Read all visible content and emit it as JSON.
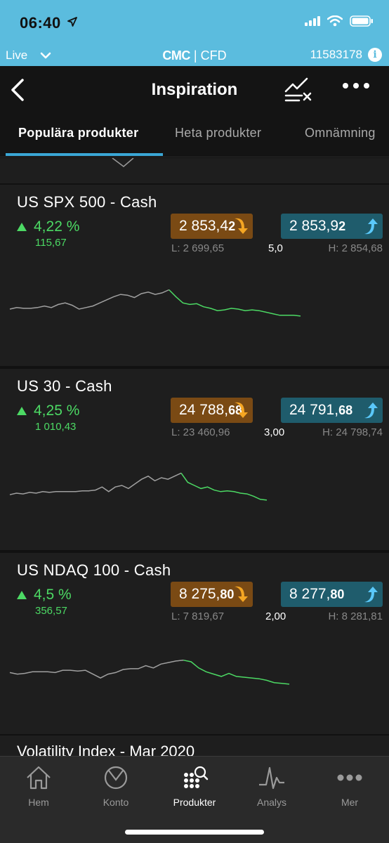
{
  "status": {
    "time": "06:40"
  },
  "subbar": {
    "mode": "Live",
    "brand_logo": "CMC",
    "brand_suffix": "| CFD",
    "account": "11583178"
  },
  "nav": {
    "title": "Inspiration"
  },
  "tabs": [
    {
      "label": "Populära produkter",
      "active": true
    },
    {
      "label": "Heta produkter",
      "active": false
    },
    {
      "label": "Omnämning",
      "active": false
    }
  ],
  "colors": {
    "accent": "#3ba7d6",
    "up": "#4cd964",
    "sell": "#7a4a14",
    "buy": "#1f5c6c",
    "arrow_sell": "#f5a623",
    "arrow_buy": "#5ac8fa"
  },
  "products": [
    {
      "name": "US SPX 500 - Cash",
      "change_pct": "4,22 %",
      "change_abs": "115,67",
      "sell_main": "2 853,4",
      "sell_big": "2",
      "buy_main": "2 853,9",
      "buy_big": "2",
      "low": "L: 2 699,65",
      "spread": "5,0",
      "high": "H: 2 854,68",
      "spark": [
        0.5,
        0.6,
        0.55,
        0.55,
        0.6,
        0.7,
        0.6,
        0.8,
        0.9,
        0.75,
        0.5,
        0.6,
        0.7,
        0.9,
        1.1,
        1.3,
        1.45,
        1.4,
        1.25,
        1.5,
        1.6,
        1.45,
        1.55,
        1.75,
        1.3,
        0.9,
        0.8,
        0.85,
        0.65,
        0.55,
        0.4,
        0.45,
        0.55,
        0.5,
        0.4,
        0.45,
        0.4,
        0.3,
        0.2,
        0.1,
        0.1,
        0.1,
        0.05
      ]
    },
    {
      "name": "US 30 - Cash",
      "change_pct": "4,25 %",
      "change_abs": "1 010,43",
      "sell_main": "24 788,",
      "sell_big": "68",
      "buy_main": "24 791,",
      "buy_big": "68",
      "low": "L: 23 460,96",
      "spread": "3,00",
      "high": "H: 24 798,74",
      "spark": [
        0.4,
        0.5,
        0.45,
        0.55,
        0.5,
        0.6,
        0.55,
        0.6,
        0.6,
        0.6,
        0.6,
        0.65,
        0.65,
        0.7,
        0.9,
        0.6,
        0.9,
        1.0,
        0.8,
        1.1,
        1.4,
        1.6,
        1.3,
        1.5,
        1.4,
        1.6,
        1.8,
        1.2,
        1.0,
        0.8,
        0.9,
        0.7,
        0.6,
        0.65,
        0.6,
        0.5,
        0.45,
        0.3,
        0.1,
        0.05
      ]
    },
    {
      "name": "US NDAQ 100 - Cash",
      "change_pct": "4,5 %",
      "change_abs": "356,57",
      "sell_main": "8 275,",
      "sell_big": "80",
      "buy_main": "8 277,",
      "buy_big": "80",
      "low": "L: 7 819,67",
      "spread": "2,00",
      "high": "H: 8 281,81",
      "spark": [
        0.8,
        0.7,
        0.75,
        0.85,
        0.85,
        0.85,
        0.8,
        0.95,
        0.95,
        0.9,
        0.95,
        0.7,
        0.45,
        0.7,
        0.8,
        1.0,
        1.05,
        1.05,
        1.25,
        1.1,
        1.35,
        1.45,
        1.55,
        1.6,
        1.5,
        1.1,
        0.85,
        0.7,
        0.55,
        0.75,
        0.55,
        0.5,
        0.45,
        0.4,
        0.3,
        0.15,
        0.1,
        0.05
      ]
    }
  ],
  "next_product": "Volatility Index - Mar 2020",
  "tabbar": [
    {
      "label": "Hem",
      "icon": "home-icon",
      "active": false
    },
    {
      "label": "Konto",
      "icon": "account-icon",
      "active": false
    },
    {
      "label": "Produkter",
      "icon": "products-icon",
      "active": true
    },
    {
      "label": "Analys",
      "icon": "analysis-icon",
      "active": false
    },
    {
      "label": "Mer",
      "icon": "more-icon",
      "active": false
    }
  ]
}
